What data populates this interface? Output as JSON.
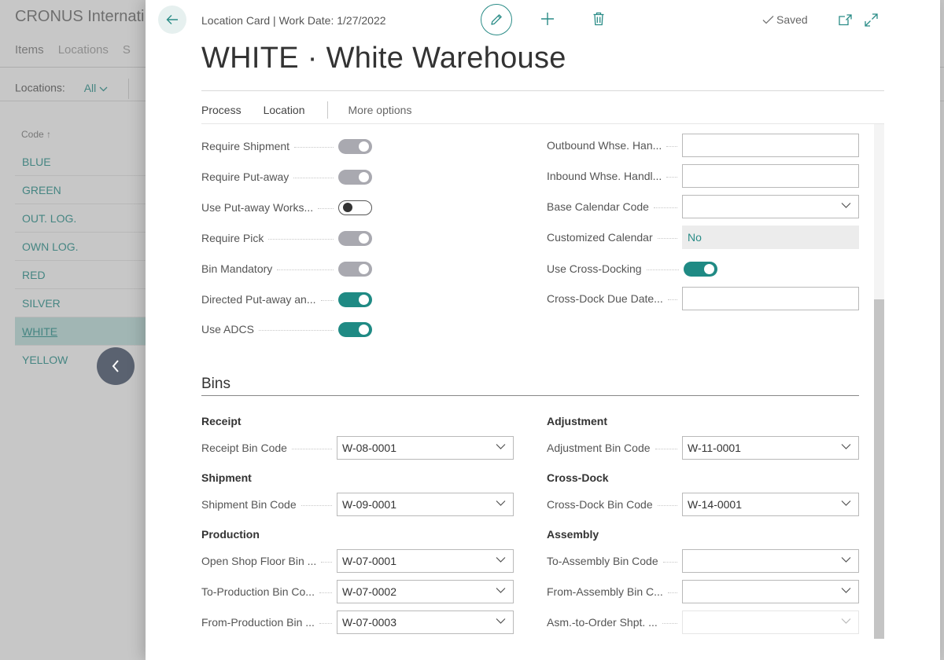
{
  "background": {
    "company": "CRONUS Internati",
    "nav": [
      "Items",
      "Locations",
      "S"
    ],
    "filter_label": "Locations:",
    "filter_value": "All",
    "column_header": "Code ↑",
    "codes": [
      "BLUE",
      "GREEN",
      "OUT. LOG.",
      "OWN LOG.",
      "RED",
      "SILVER",
      "WHITE",
      "YELLOW"
    ],
    "selected_code": "WHITE"
  },
  "card": {
    "breadcrumb": "Location Card | Work Date: 1/27/2022",
    "saved_label": "Saved",
    "title": "WHITE · White Warehouse",
    "actions": [
      "Process",
      "Location"
    ],
    "more_options": "More options"
  },
  "left_toggles": [
    {
      "label": "Require Shipment",
      "state": "disabled"
    },
    {
      "label": "Require Put-away",
      "state": "disabled"
    },
    {
      "label": "Use Put-away Works...",
      "state": "off"
    },
    {
      "label": "Require Pick",
      "state": "disabled"
    },
    {
      "label": "Bin Mandatory",
      "state": "disabled"
    },
    {
      "label": "Directed Put-away an...",
      "state": "on"
    },
    {
      "label": "Use ADCS",
      "state": "on"
    }
  ],
  "right_fields": {
    "outbound_whse": {
      "label": "Outbound Whse. Han...",
      "value": ""
    },
    "inbound_whse": {
      "label": "Inbound Whse. Handl...",
      "value": ""
    },
    "base_calendar": {
      "label": "Base Calendar Code",
      "value": ""
    },
    "customized_calendar": {
      "label": "Customized Calendar",
      "value": "No"
    },
    "use_cross_docking": {
      "label": "Use Cross-Docking",
      "state": "on"
    },
    "cross_dock_due": {
      "label": "Cross-Dock Due Date...",
      "value": ""
    }
  },
  "bins": {
    "title": "Bins",
    "receipt": {
      "group": "Receipt",
      "label": "Receipt Bin Code",
      "value": "W-08-0001"
    },
    "shipment": {
      "group": "Shipment",
      "label": "Shipment Bin Code",
      "value": "W-09-0001"
    },
    "production": {
      "group": "Production",
      "open_shop": {
        "label": "Open Shop Floor Bin ...",
        "value": "W-07-0001"
      },
      "to_production": {
        "label": "To-Production Bin Co...",
        "value": "W-07-0002"
      },
      "from_production": {
        "label": "From-Production Bin ...",
        "value": "W-07-0003"
      }
    },
    "adjustment": {
      "group": "Adjustment",
      "label": "Adjustment Bin Code",
      "value": "W-11-0001"
    },
    "cross_dock": {
      "group": "Cross-Dock",
      "label": "Cross-Dock Bin Code",
      "value": "W-14-0001"
    },
    "assembly": {
      "group": "Assembly",
      "to_assembly": {
        "label": "To-Assembly Bin Code",
        "value": ""
      },
      "from_assembly": {
        "label": "From-Assembly Bin C...",
        "value": ""
      },
      "asm_to_order": {
        "label": "Asm.-to-Order Shpt. ...",
        "value": ""
      }
    }
  },
  "colors": {
    "accent": "#2a8c87",
    "toggle_on": "#1f8a84",
    "toggle_disabled": "#a9a9b0"
  }
}
